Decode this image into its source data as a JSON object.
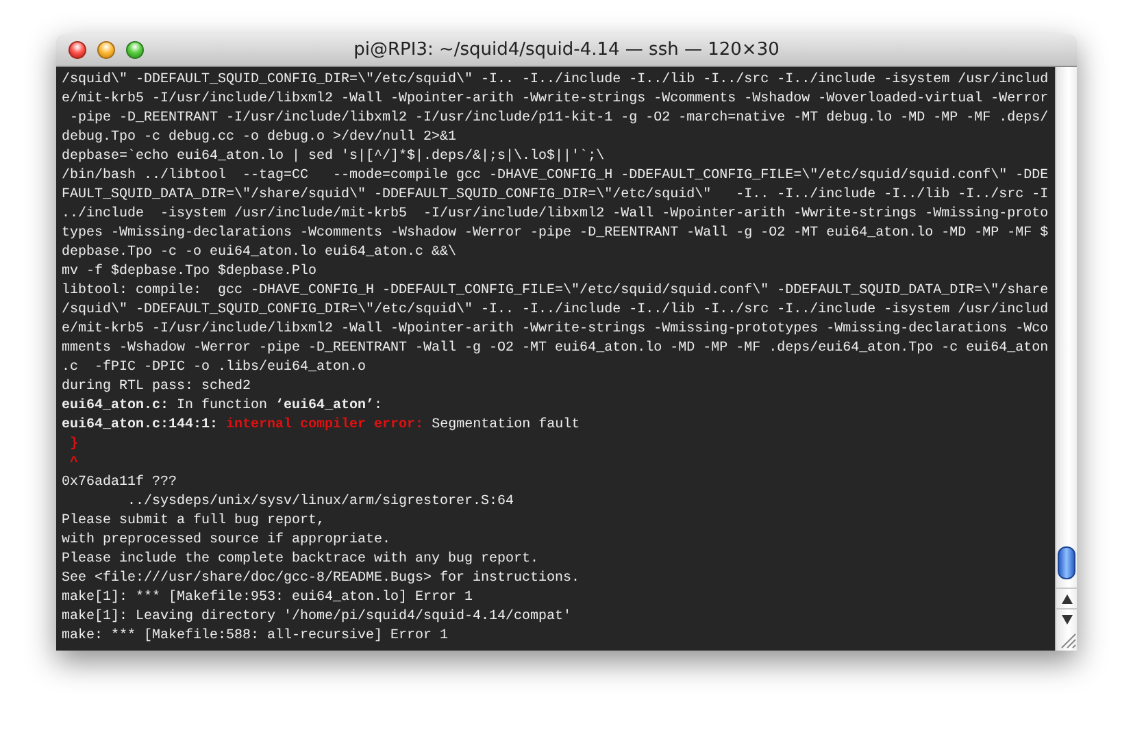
{
  "window": {
    "title": "pi@RPI3: ~/squid4/squid-4.14 — ssh — 120×30"
  },
  "terminal": {
    "lines": [
      {
        "text": "/squid\\\" -DDEFAULT_SQUID_CONFIG_DIR=\\\"/etc/squid\\\" -I.. -I../include -I../lib -I../src -I../include -isystem /usr/includ"
      },
      {
        "text": "e/mit-krb5 -I/usr/include/libxml2 -Wall -Wpointer-arith -Wwrite-strings -Wcomments -Wshadow -Woverloaded-virtual -Werror"
      },
      {
        "text": " -pipe -D_REENTRANT -I/usr/include/libxml2 -I/usr/include/p11-kit-1 -g -O2 -march=native -MT debug.lo -MD -MP -MF .deps/"
      },
      {
        "text": "debug.Tpo -c debug.cc -o debug.o >/dev/null 2>&1"
      },
      {
        "text": "depbase=`echo eui64_aton.lo | sed 's|[^/]*$|.deps/&|;s|\\.lo$||'`;\\"
      },
      {
        "text": "/bin/bash ../libtool  --tag=CC   --mode=compile gcc -DHAVE_CONFIG_H -DDEFAULT_CONFIG_FILE=\\\"/etc/squid/squid.conf\\\" -DDE"
      },
      {
        "text": "FAULT_SQUID_DATA_DIR=\\\"/share/squid\\\" -DDEFAULT_SQUID_CONFIG_DIR=\\\"/etc/squid\\\"   -I.. -I../include -I../lib -I../src -I"
      },
      {
        "text": "../include  -isystem /usr/include/mit-krb5  -I/usr/include/libxml2 -Wall -Wpointer-arith -Wwrite-strings -Wmissing-proto"
      },
      {
        "text": "types -Wmissing-declarations -Wcomments -Wshadow -Werror -pipe -D_REENTRANT -Wall -g -O2 -MT eui64_aton.lo -MD -MP -MF $"
      },
      {
        "text": "depbase.Tpo -c -o eui64_aton.lo eui64_aton.c &&\\"
      },
      {
        "text": "mv -f $depbase.Tpo $depbase.Plo"
      },
      {
        "text": "libtool: compile:  gcc -DHAVE_CONFIG_H -DDEFAULT_CONFIG_FILE=\\\"/etc/squid/squid.conf\\\" -DDEFAULT_SQUID_DATA_DIR=\\\"/share"
      },
      {
        "text": "/squid\\\" -DDEFAULT_SQUID_CONFIG_DIR=\\\"/etc/squid\\\" -I.. -I../include -I../lib -I../src -I../include -isystem /usr/includ"
      },
      {
        "text": "e/mit-krb5 -I/usr/include/libxml2 -Wall -Wpointer-arith -Wwrite-strings -Wmissing-prototypes -Wmissing-declarations -Wco"
      },
      {
        "text": "mments -Wshadow -Werror -pipe -D_REENTRANT -Wall -g -O2 -MT eui64_aton.lo -MD -MP -MF .deps/eui64_aton.Tpo -c eui64_aton"
      },
      {
        "text": ".c  -fPIC -DPIC -o .libs/eui64_aton.o"
      },
      {
        "text": "during RTL pass: sched2"
      },
      {
        "spans": [
          {
            "text": "eui64_aton.c:",
            "kind": "bold"
          },
          {
            "text": " In function ",
            "kind": "plain"
          },
          {
            "text": "‘eui64_aton’",
            "kind": "bold"
          },
          {
            "text": ":",
            "kind": "plain"
          }
        ]
      },
      {
        "spans": [
          {
            "text": "eui64_aton.c:144:1: ",
            "kind": "bold"
          },
          {
            "text": "internal compiler error:",
            "kind": "error"
          },
          {
            "text": " Segmentation fault",
            "kind": "plain"
          }
        ]
      },
      {
        "spans": [
          {
            "text": " }",
            "kind": "error"
          }
        ]
      },
      {
        "spans": [
          {
            "text": " ^",
            "kind": "error"
          }
        ]
      },
      {
        "text": "0x76ada11f ???"
      },
      {
        "text": "        ../sysdeps/unix/sysv/linux/arm/sigrestorer.S:64"
      },
      {
        "text": "Please submit a full bug report,"
      },
      {
        "text": "with preprocessed source if appropriate."
      },
      {
        "text": "Please include the complete backtrace with any bug report."
      },
      {
        "text": "See <file:///usr/share/doc/gcc-8/README.Bugs> for instructions."
      },
      {
        "text": "make[1]: *** [Makefile:953: eui64_aton.lo] Error 1"
      },
      {
        "text": "make[1]: Leaving directory '/home/pi/squid4/squid-4.14/compat'"
      },
      {
        "text": "make: *** [Makefile:588: all-recursive] Error 1"
      }
    ]
  }
}
